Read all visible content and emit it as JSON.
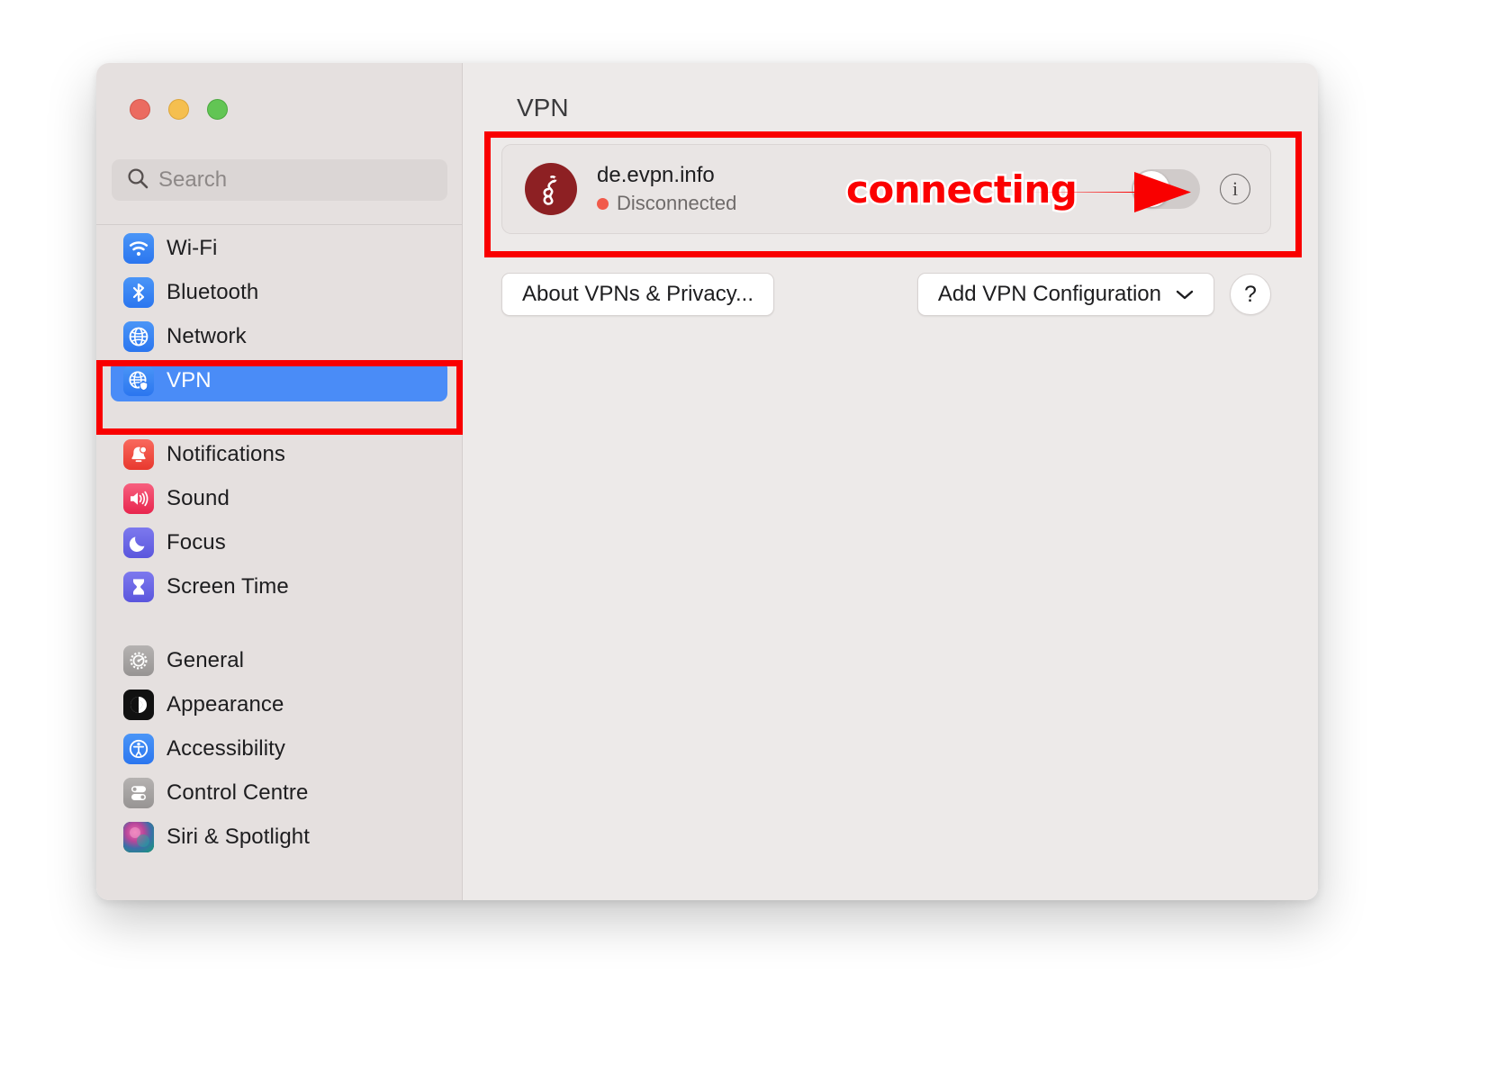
{
  "window": {
    "traffic_lights": [
      {
        "name": "close",
        "color": "#eb6b60"
      },
      {
        "name": "minimize",
        "color": "#f5bf4f"
      },
      {
        "name": "maximize",
        "color": "#62c554"
      }
    ]
  },
  "sidebar": {
    "search": {
      "value": "",
      "placeholder": "Search",
      "icon": "search-icon"
    },
    "groups": [
      {
        "items": [
          {
            "label": "Wi-Fi",
            "icon": "wifi-icon",
            "selected": false
          },
          {
            "label": "Bluetooth",
            "icon": "bluetooth-icon",
            "selected": false
          },
          {
            "label": "Network",
            "icon": "globe-icon",
            "selected": false
          },
          {
            "label": "VPN",
            "icon": "globe-shield-icon",
            "selected": true
          }
        ]
      },
      {
        "items": [
          {
            "label": "Notifications",
            "icon": "bell-icon",
            "selected": false
          },
          {
            "label": "Sound",
            "icon": "speaker-icon",
            "selected": false
          },
          {
            "label": "Focus",
            "icon": "moon-icon",
            "selected": false
          },
          {
            "label": "Screen Time",
            "icon": "hourglass-icon",
            "selected": false
          }
        ]
      },
      {
        "items": [
          {
            "label": "General",
            "icon": "gear-icon",
            "selected": false
          },
          {
            "label": "Appearance",
            "icon": "appearance-icon",
            "selected": false
          },
          {
            "label": "Accessibility",
            "icon": "accessibility-icon",
            "selected": false
          },
          {
            "label": "Control Centre",
            "icon": "switches-icon",
            "selected": false
          },
          {
            "label": "Siri & Spotlight",
            "icon": "siri-icon",
            "selected": false
          }
        ]
      }
    ]
  },
  "main": {
    "title": "VPN",
    "vpn_row": {
      "name": "de.evpn.info",
      "status": "Disconnected",
      "status_color": "#f15a4a",
      "logo_bg": "#8d2023",
      "toggle_on": false,
      "info_label": "i"
    },
    "buttons": {
      "about": "About VPNs & Privacy...",
      "add_config": "Add VPN Configuration",
      "add_config_chevron": "chevron-down-icon",
      "help": "?"
    }
  },
  "annotations": {
    "connecting_label": "connecting",
    "highlight_color": "#f90000",
    "boxes": [
      "vpn-row-highlight",
      "sidebar-vpn-highlight"
    ],
    "arrow": "arrow-pointing-to-toggle"
  }
}
